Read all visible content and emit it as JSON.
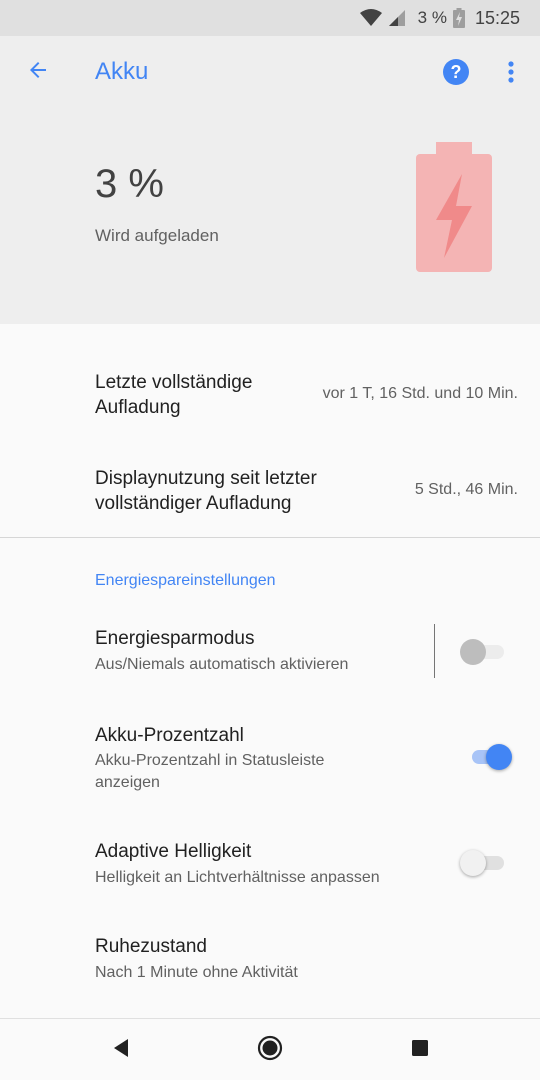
{
  "status_bar": {
    "battery_percent": "3 %",
    "time": "15:25"
  },
  "app_bar": {
    "title": "Akku"
  },
  "header": {
    "percent": "3 %",
    "status": "Wird aufgeladen"
  },
  "items": [
    {
      "title_line1": "Letzte vollständige",
      "title_line2": "Aufladung",
      "value": "vor 1 T, 16 Std. und 10 Min."
    },
    {
      "title_line1": "Displaynutzung seit letzter",
      "title_line2": "vollständiger Aufladung",
      "value": "5 Std., 46 Min."
    }
  ],
  "section": {
    "title": "Energiespareinstellungen"
  },
  "settings": [
    {
      "title": "Energiesparmodus",
      "subtitle": "Aus/Niemals automatisch aktivieren",
      "toggle": "off"
    },
    {
      "title": "Akku-Prozentzahl",
      "subtitle_line1": "Akku-Prozentzahl in Statusleiste",
      "subtitle_line2": "anzeigen",
      "toggle": "on"
    },
    {
      "title": "Adaptive Helligkeit",
      "subtitle": "Helligkeit an Lichtverhältnisse anpassen",
      "toggle": "off"
    },
    {
      "title": "Ruhezustand",
      "subtitle": "Nach 1 Minute ohne Aktivität"
    }
  ],
  "colors": {
    "accent": "#4285f4",
    "battery_fill": "#f4b4b4",
    "battery_bolt": "#f08a8a"
  },
  "icons": [
    "wifi-icon",
    "cell-signal-icon",
    "battery-charging-icon",
    "back-arrow-icon",
    "help-icon",
    "more-vert-icon",
    "battery-charging-large-icon",
    "nav-back-icon",
    "nav-home-icon",
    "nav-recents-icon"
  ]
}
